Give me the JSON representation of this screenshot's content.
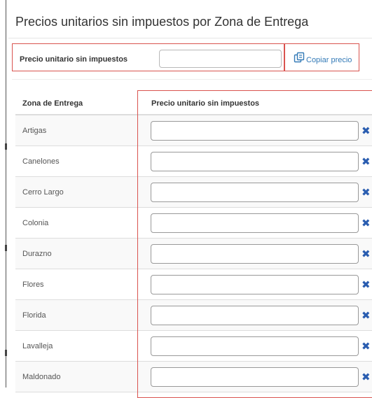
{
  "header": {
    "title": "Precios unitarios sin impuestos por Zona de Entrega"
  },
  "copy_section": {
    "label": "Precio unitario sin impuestos",
    "input_value": "",
    "button_label": "Copiar precio",
    "button_icon": "copy-icon"
  },
  "table": {
    "headers": {
      "zone": "Zona de Entrega",
      "price": "Precio unitario sin impuestos"
    },
    "rows": [
      {
        "zone": "Artigas",
        "price": ""
      },
      {
        "zone": "Canelones",
        "price": ""
      },
      {
        "zone": "Cerro Largo",
        "price": ""
      },
      {
        "zone": "Colonia",
        "price": ""
      },
      {
        "zone": "Durazno",
        "price": ""
      },
      {
        "zone": "Flores",
        "price": ""
      },
      {
        "zone": "Florida",
        "price": ""
      },
      {
        "zone": "Lavalleja",
        "price": ""
      },
      {
        "zone": "Maldonado",
        "price": ""
      }
    ],
    "clear_icon": "close-icon"
  },
  "colors": {
    "highlight_border": "#d9534f",
    "link": "#337ab7",
    "clear_icon": "#2a5db0",
    "stripe": "#f9f9f9"
  }
}
